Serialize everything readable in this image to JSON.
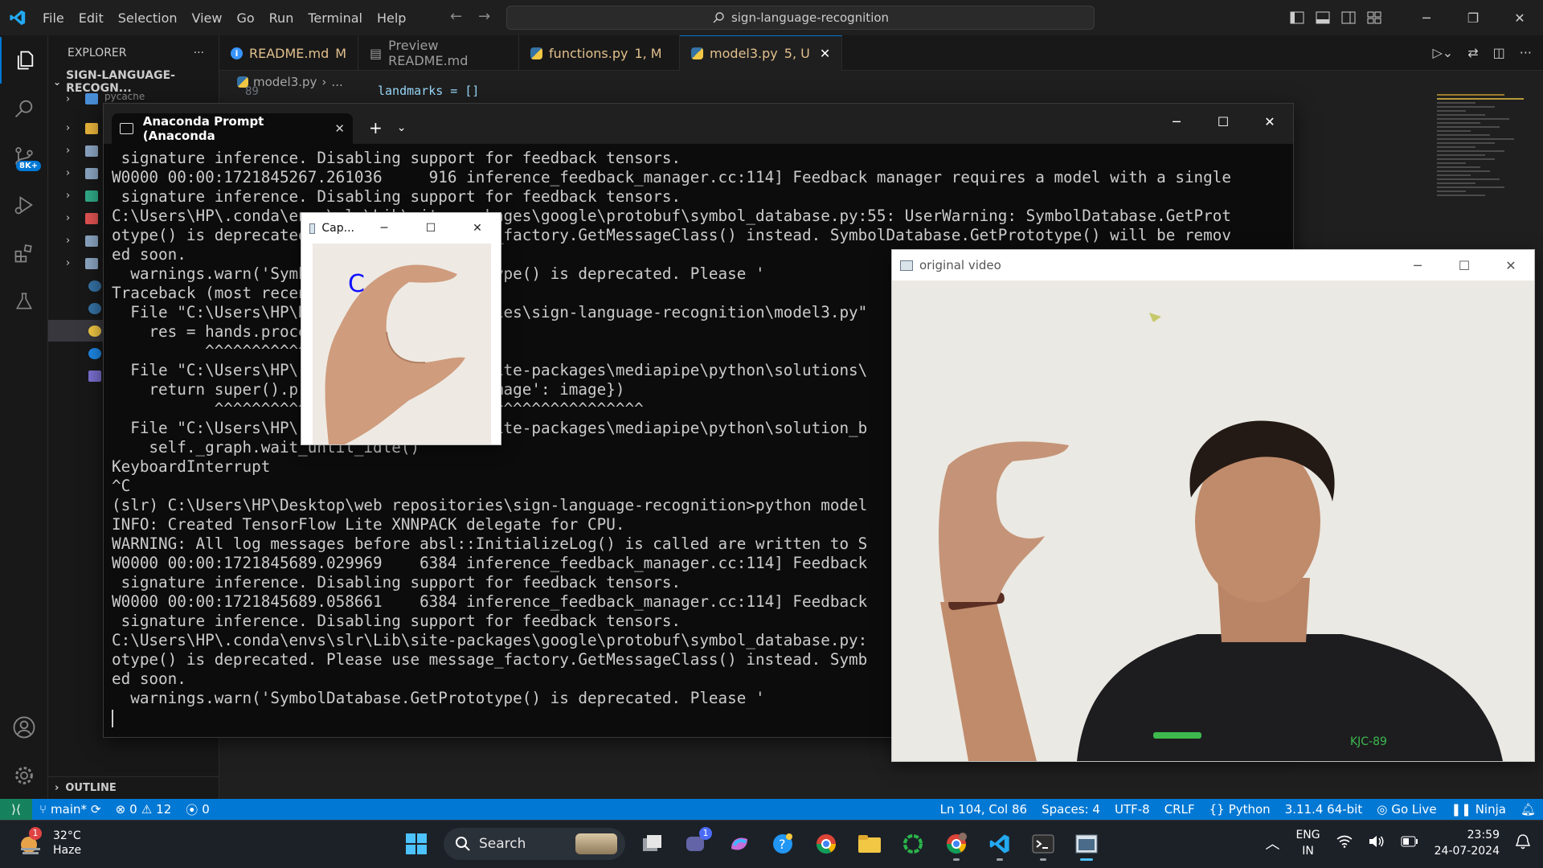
{
  "titlebar": {
    "menu": [
      "File",
      "Edit",
      "Selection",
      "View",
      "Go",
      "Run",
      "Terminal",
      "Help"
    ],
    "search_text": "sign-language-recognition"
  },
  "activitybar": {
    "scm_badge": "8K+"
  },
  "sidebar": {
    "title": "EXPLORER",
    "more": "···",
    "project": "SIGN-LANGUAGE-RECOGN...",
    "peek_item": "pycache",
    "outline_label": "OUTLINE"
  },
  "tabs": [
    {
      "label": "README.md",
      "badge": "M"
    },
    {
      "label": "Preview README.md",
      "badge": ""
    },
    {
      "label": "functions.py",
      "badge": "1, M"
    },
    {
      "label": "model3.py",
      "badge": "5, U"
    }
  ],
  "breadcrumb": {
    "file": "model3.py",
    "rest": "..."
  },
  "editor": {
    "peek_line_num": "89",
    "peek_code": "landmarks = []"
  },
  "terminal": {
    "tab_title": "Anaconda Prompt (Anaconda",
    "lines": [
      " signature inference. Disabling support for feedback tensors.",
      "W0000 00:00:1721845267.261036     916 inference_feedback_manager.cc:114] Feedback manager requires a model with a single",
      " signature inference. Disabling support for feedback tensors.",
      "C:\\Users\\HP\\.conda\\envs\\slr\\Lib\\site-packages\\google\\protobuf\\symbol_database.py:55: UserWarning: SymbolDatabase.GetProt",
      "otype() is deprecated. Please use message_factory.GetMessageClass() instead. SymbolDatabase.GetPrototype() will be remov",
      "ed soon.",
      "  warnings.warn('SymbolDatabase.GetPrototype() is deprecated. Please '",
      "Traceback (most recent call last):",
      "  File \"C:\\Users\\HP\\Desktop\\web repositories\\sign-language-recognition\\model3.py\"",
      "    res = hands.process(img)",
      "          ^^^^^^^^^^^^^^^^^^",
      "  File \"C:\\Users\\HP\\.conda\\envs\\slr\\Lib\\site-packages\\mediapipe\\python\\solutions\\",
      "    return super().process(input_data={'image': image})",
      "           ^^^^^^^^^^^^^^^^^^^^^^^^^^^^^^^^^^^^^^^^^^^^^^",
      "  File \"C:\\Users\\HP\\.conda\\envs\\slr\\Lib\\site-packages\\mediapipe\\python\\solution_b",
      "    self._graph.wait_until_idle()",
      "KeyboardInterrupt",
      "^C",
      "(slr) C:\\Users\\HP\\Desktop\\web repositories\\sign-language-recognition>python model",
      "INFO: Created TensorFlow Lite XNNPACK delegate for CPU.",
      "WARNING: All log messages before absl::InitializeLog() is called are written to S",
      "W0000 00:00:1721845689.029969    6384 inference_feedback_manager.cc:114] Feedback",
      " signature inference. Disabling support for feedback tensors.",
      "W0000 00:00:1721845689.058661    6384 inference_feedback_manager.cc:114] Feedback",
      " signature inference. Disabling support for feedback tensors.",
      "C:\\Users\\HP\\.conda\\envs\\slr\\Lib\\site-packages\\google\\protobuf\\symbol_database.py:",
      "otype() is deprecated. Please use message_factory.GetMessageClass() instead. Symb",
      "ed soon.",
      "  warnings.warn('SymbolDatabase.GetPrototype() is deprecated. Please '"
    ]
  },
  "capture_window": {
    "title": "Cap...",
    "prediction": "C"
  },
  "video_window": {
    "title": "original video",
    "shirt_text": "KJC-89"
  },
  "statusbar": {
    "branch": "main*",
    "errors": "0",
    "warnings": "12",
    "ports": "0",
    "position": "Ln 104, Col 86",
    "spaces": "Spaces: 4",
    "encoding": "UTF-8",
    "eol": "CRLF",
    "language": "Python",
    "interpreter": "3.11.4 64-bit",
    "golive": "Go Live",
    "ninja": "Ninja"
  },
  "taskbar": {
    "weather_temp": "32°C",
    "weather_desc": "Haze",
    "weather_badge": "1",
    "search_label": "Search",
    "teams_badge": "1",
    "lang_top": "ENG",
    "lang_bottom": "IN",
    "time": "23:59",
    "date": "24-07-2024"
  },
  "colors": {
    "accent": "#0078d4",
    "statusbar": "#0078d4",
    "remote": "#16825d",
    "modified": "#e2c08d"
  }
}
